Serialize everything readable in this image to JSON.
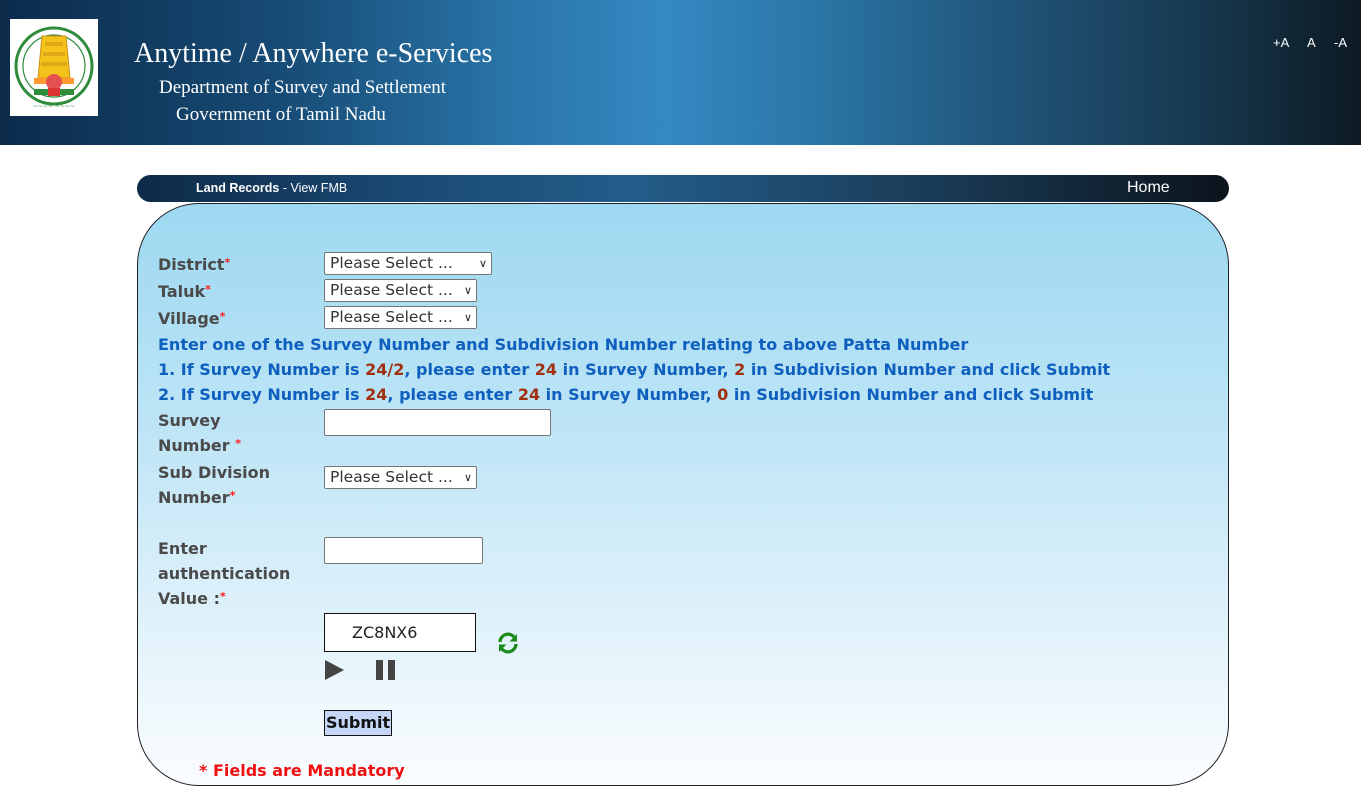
{
  "header": {
    "title": "Anytime / Anywhere e-Services",
    "department": "Department of Survey and Settlement",
    "government": "Government of Tamil Nadu",
    "logo_icon": "tamil-nadu-emblem-icon",
    "font_controls": {
      "increase": "+A",
      "normal": "A",
      "decrease": "-A"
    }
  },
  "navbar": {
    "section": "Land Records",
    "separator": " - ",
    "page": "View FMB",
    "home_label": "Home"
  },
  "form": {
    "required_marker": "*",
    "district": {
      "label": "District",
      "value": "Please Select ..."
    },
    "taluk": {
      "label": "Taluk",
      "value": "Please Select ..."
    },
    "village": {
      "label": "Village",
      "value": "Please Select ..."
    },
    "instructions": {
      "heading": "Enter one of the Survey Number and Subdivision Number relating to above Patta Number",
      "line1": {
        "p1": "1. If Survey Number is ",
        "v1": "24/2",
        "p2": ", please enter ",
        "v2": "24",
        "p3": " in Survey Number, ",
        "v3": "2",
        "p4": " in Subdivision Number and click Submit"
      },
      "line2": {
        "p1": "2. If Survey Number is ",
        "v1": "24",
        "p2": ", please enter ",
        "v2": "24",
        "p3": " in Survey Number, ",
        "v3": "0",
        "p4": " in Subdivision Number and click Submit"
      }
    },
    "survey_number": {
      "label_line1": "Survey",
      "label_line2": "Number ",
      "value": ""
    },
    "sub_division": {
      "label_line1": "Sub Division",
      "label_line2": "Number",
      "value": "Please Select ..."
    },
    "auth": {
      "label_line1": "Enter",
      "label_line2": "authentication",
      "label_line3": "Value :",
      "value": ""
    },
    "captcha": {
      "text": "ZC8NX6",
      "refresh_icon": "refresh-icon",
      "play_icon": "play-icon",
      "pause_icon": "pause-icon"
    },
    "submit_label": "Submit",
    "mandatory_note": "* Fields are Mandatory"
  },
  "colors": {
    "label": "#4a4a4a",
    "instruction": "#0f5fbf",
    "highlight": "#a0300f",
    "required": "#ff1a1a",
    "refresh": "#1a8a1a",
    "submit_bg": "#c5d6f7"
  }
}
